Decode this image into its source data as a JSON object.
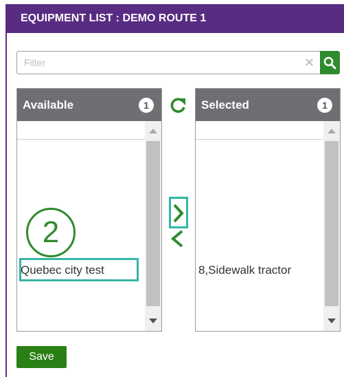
{
  "dialog": {
    "title": "EQUIPMENT LIST : DEMO ROUTE 1"
  },
  "filter": {
    "placeholder": "Filter",
    "value": ""
  },
  "available": {
    "header": "Available",
    "count": "1",
    "items": [
      "Quebec city test"
    ]
  },
  "selected": {
    "header": "Selected",
    "count": "1",
    "items": [
      "8,Sidewalk tractor"
    ]
  },
  "annotation": {
    "step": "2"
  },
  "actions": {
    "save_label": "Save"
  },
  "colors": {
    "titlebar": "#582c83",
    "accent_green": "#2e8b2e",
    "panel_header": "#6d6f73",
    "highlight": "#35b5a5"
  },
  "icons": {
    "clear": "close-icon",
    "search": "search-icon",
    "refresh": "refresh-icon",
    "move_right": "chevron-right-icon",
    "move_left": "chevron-left-icon"
  }
}
